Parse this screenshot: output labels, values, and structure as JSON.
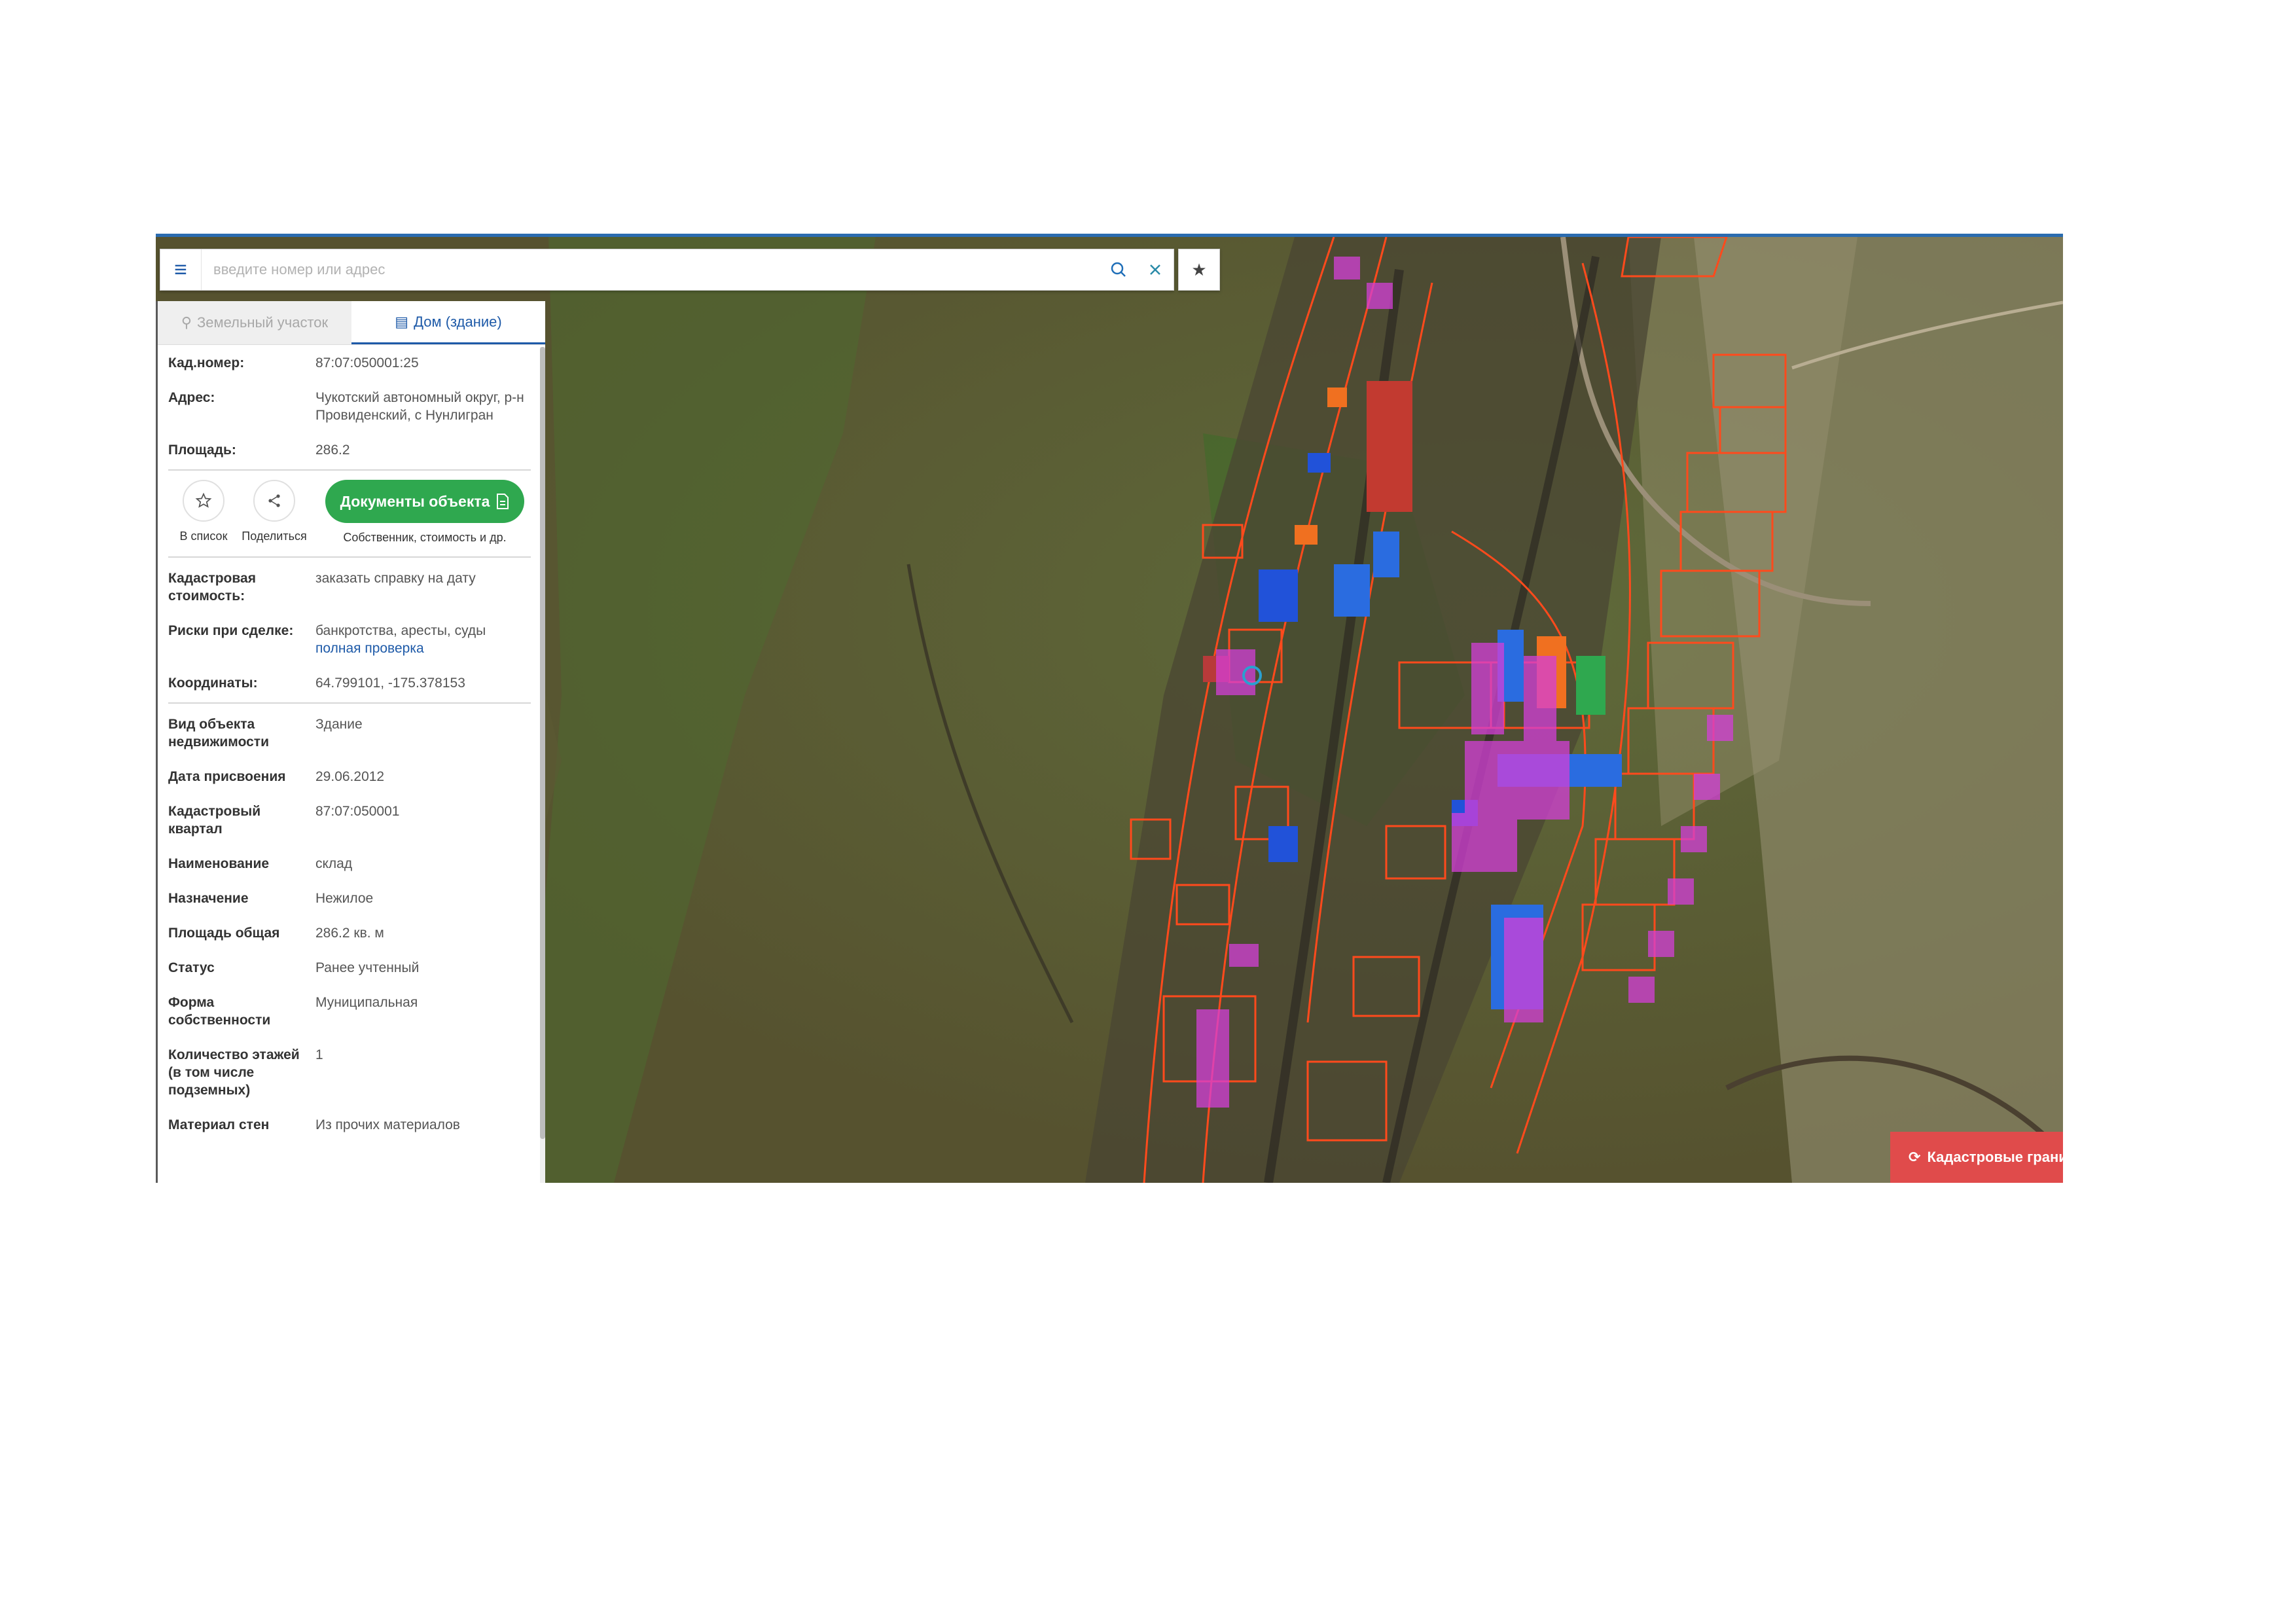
{
  "search": {
    "placeholder": "введите номер или адрес",
    "value": ""
  },
  "icons": {
    "menu": "menu-icon",
    "search": "search-icon",
    "clear": "close-icon",
    "favorite": "star-icon",
    "tab_land": "land-plot-icon",
    "tab_building": "building-icon",
    "list": "star-outline-icon",
    "share": "share-icon",
    "document": "document-icon",
    "refresh": "refresh-icon"
  },
  "tabs": [
    {
      "label": "Земельный участок",
      "active": false
    },
    {
      "label": "Дом (здание)",
      "active": true
    }
  ],
  "summary": {
    "cad_number": {
      "label": "Кад.номер:",
      "value": "87:07:050001:25"
    },
    "address": {
      "label": "Адрес:",
      "value": "Чукотский автономный округ, р-н Провиденский, с Нунлигран"
    },
    "area": {
      "label": "Площадь:",
      "value": "286.2"
    }
  },
  "actions": {
    "list_label": "В список",
    "share_label": "Поделиться",
    "docs_label": "Документы объекта",
    "docs_sub": "Собственник, стоимость и др."
  },
  "details": {
    "cad_cost": {
      "label": "Кадастровая стоимость:",
      "link": "заказать справку на дату"
    },
    "risks": {
      "label": "Риски при сделке:",
      "value": "банкротства, аресты, суды",
      "link": "полная проверка"
    },
    "coords": {
      "label": "Координаты:",
      "value": "64.799101, -175.378153"
    }
  },
  "properties": [
    {
      "label": "Вид объекта недвижимости",
      "value": "Здание"
    },
    {
      "label": "Дата присвоения",
      "value": "29.06.2012"
    },
    {
      "label": "Кадастровый квартал",
      "value": "87:07:050001"
    },
    {
      "label": "Наименование",
      "value": "склад"
    },
    {
      "label": "Назначение",
      "value": "Нежилое"
    },
    {
      "label": "Площадь общая",
      "value": "286.2 кв. м"
    },
    {
      "label": "Статус",
      "value": "Ранее учтенный"
    },
    {
      "label": "Форма собственности",
      "value": "Муниципальная"
    },
    {
      "label": "Количество этажей (в том числе подземных)",
      "value": "1"
    },
    {
      "label": "Материал стен",
      "value": "Из прочих материалов"
    }
  ],
  "map": {
    "cad_borders_button": "Кадастровые грани"
  },
  "colors": {
    "accent": "#1e5aa8",
    "docs_button": "#2fa84f",
    "cad_button": "#e04b4b",
    "parcel_outline": "#ff4a1c",
    "building_fill": "#d43fd8"
  }
}
